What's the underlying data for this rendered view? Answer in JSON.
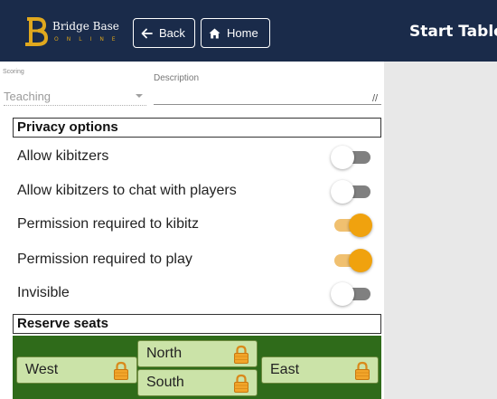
{
  "header": {
    "logo_name": "Bridge Base",
    "logo_sub": "ONLINE",
    "back_label": "Back",
    "home_label": "Home",
    "title": "Start Table"
  },
  "scoring": {
    "label": "Scoring",
    "value": "Teaching"
  },
  "description": {
    "label": "Description",
    "value": ""
  },
  "privacy": {
    "title": "Privacy options",
    "options": [
      {
        "label": "Allow kibitzers",
        "enabled": false
      },
      {
        "label": "Allow kibitzers to chat with players",
        "enabled": false
      },
      {
        "label": "Permission required to kibitz",
        "enabled": true
      },
      {
        "label": "Permission required to play",
        "enabled": true
      },
      {
        "label": "Invisible",
        "enabled": false
      }
    ]
  },
  "reserve": {
    "title": "Reserve seats",
    "seats": {
      "west": "West",
      "north": "North",
      "south": "South",
      "east": "East"
    }
  },
  "colors": {
    "topbar": "#1a2b4a",
    "accent": "#f0a20e",
    "seats_background": "#2f6b1a",
    "seat_fill": "#cbe3a8"
  },
  "icons": {
    "back": "arrow-left-icon",
    "home": "home-icon",
    "lock": "lock-icon"
  }
}
